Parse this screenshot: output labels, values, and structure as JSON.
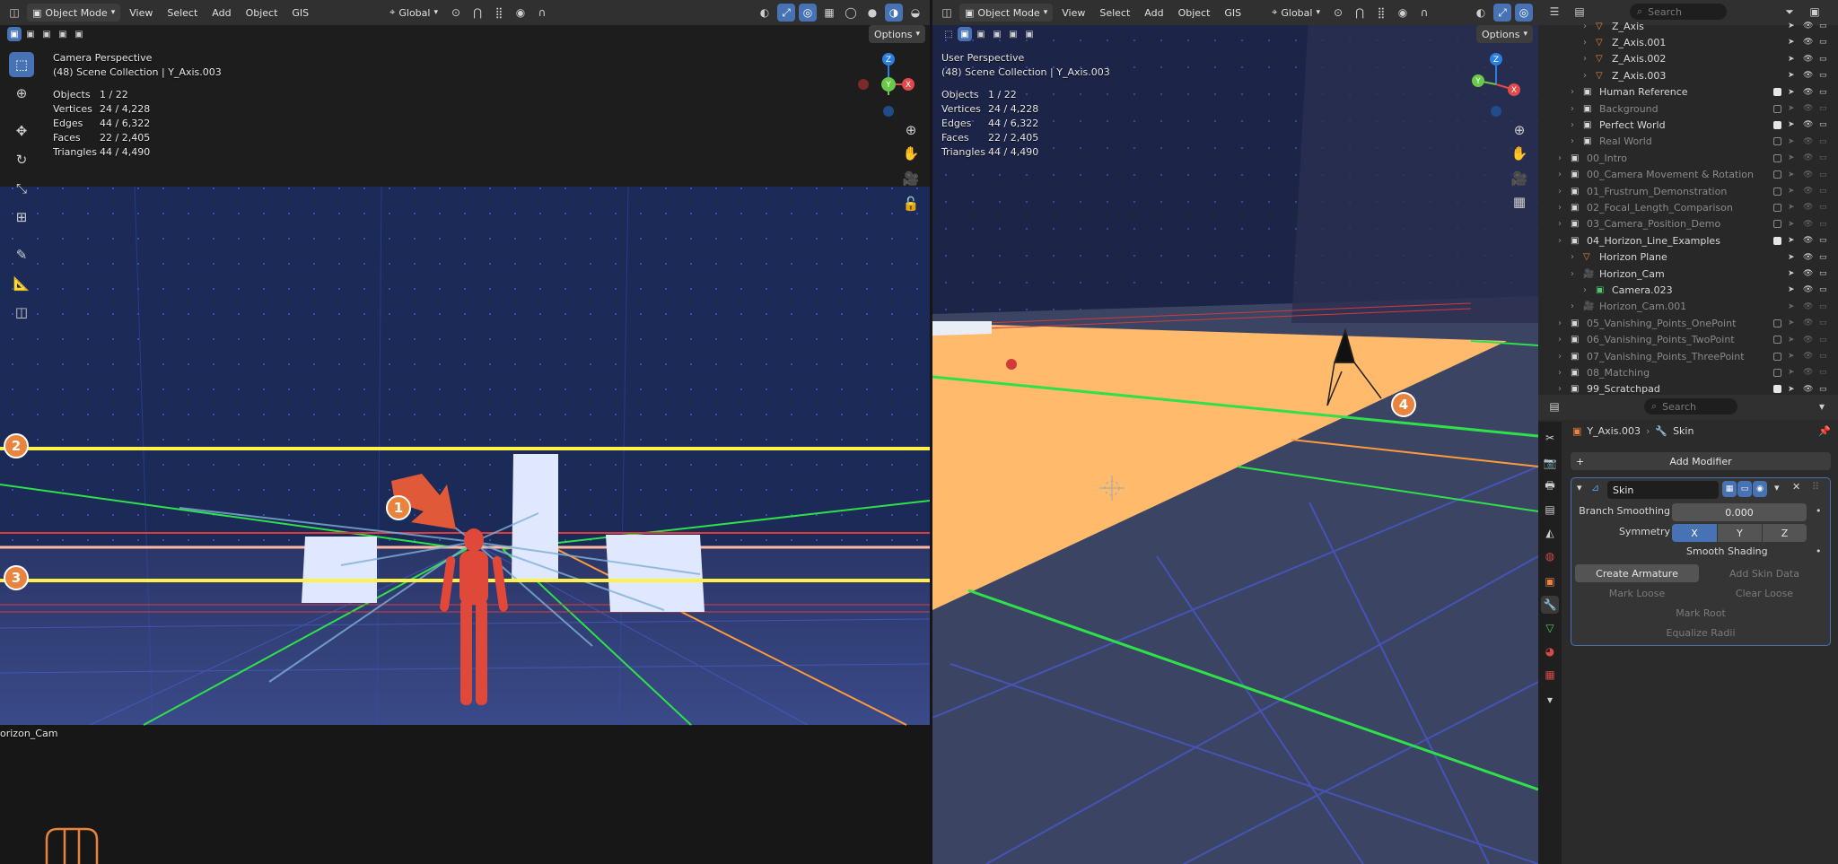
{
  "app": {
    "left_header": {
      "mode": "Object Mode",
      "menus": [
        "View",
        "Select",
        "Add",
        "Object",
        "GIS"
      ],
      "transform": "Global",
      "options": "Options"
    },
    "right_header": {
      "mode": "Object Mode",
      "menus": [
        "View",
        "Select",
        "Add",
        "Object",
        "GIS"
      ],
      "transform": "Global",
      "options": "Options"
    }
  },
  "left_viewport": {
    "title": "Camera Perspective",
    "collection": "(48) Scene Collection | Y_Axis.003",
    "stats": [
      {
        "k": "Objects",
        "v": "1 / 22"
      },
      {
        "k": "Vertices",
        "v": "24 / 4,228"
      },
      {
        "k": "Edges",
        "v": "44 / 6,322"
      },
      {
        "k": "Faces",
        "v": "22 / 2,405"
      },
      {
        "k": "Triangles",
        "v": "44 / 4,490"
      }
    ],
    "camera_name": "orizon_Cam",
    "badges": [
      "1",
      "2",
      "3"
    ]
  },
  "right_viewport": {
    "title": "User Perspective",
    "collection": "(48) Scene Collection | Y_Axis.003",
    "stats": [
      {
        "k": "Objects",
        "v": "1 / 22"
      },
      {
        "k": "Vertices",
        "v": "24 / 4,228"
      },
      {
        "k": "Edges",
        "v": "44 / 6,322"
      },
      {
        "k": "Faces",
        "v": "22 / 2,405"
      },
      {
        "k": "Triangles",
        "v": "44 / 4,490"
      }
    ],
    "badges": [
      "4"
    ]
  },
  "gizmo": {
    "x": "X",
    "y": "Y",
    "z": "Z"
  },
  "outliner": {
    "search_placeholder": "Search",
    "rows": [
      {
        "name": "Z_Axis",
        "indent": 3,
        "type": "mesh",
        "dim": false,
        "check": false
      },
      {
        "name": "Z_Axis.001",
        "indent": 3,
        "type": "mesh",
        "dim": false,
        "check": false
      },
      {
        "name": "Z_Axis.002",
        "indent": 3,
        "type": "mesh",
        "dim": false,
        "check": false
      },
      {
        "name": "Z_Axis.003",
        "indent": 3,
        "type": "mesh",
        "dim": false,
        "check": false
      },
      {
        "name": "Human Reference",
        "indent": 2,
        "type": "collection",
        "dim": false,
        "check": true
      },
      {
        "name": "Background",
        "indent": 2,
        "type": "collection",
        "dim": true,
        "check": false
      },
      {
        "name": "Perfect World",
        "indent": 2,
        "type": "collection",
        "dim": false,
        "check": true
      },
      {
        "name": "Real World",
        "indent": 2,
        "type": "collection",
        "dim": true,
        "check": false
      },
      {
        "name": "00_Intro",
        "indent": 1,
        "type": "collection",
        "dim": true,
        "check": false
      },
      {
        "name": "00_Camera Movement & Rotation",
        "indent": 1,
        "type": "collection",
        "dim": true,
        "check": false
      },
      {
        "name": "01_Frustrum_Demonstration",
        "indent": 1,
        "type": "collection",
        "dim": true,
        "check": false
      },
      {
        "name": "02_Focal_Length_Comparison",
        "indent": 1,
        "type": "collection",
        "dim": true,
        "check": false
      },
      {
        "name": "03_Camera_Position_Demo",
        "indent": 1,
        "type": "collection",
        "dim": true,
        "check": false
      },
      {
        "name": "04_Horizon_Line_Examples",
        "indent": 1,
        "type": "collection",
        "dim": false,
        "check": true
      },
      {
        "name": "Horizon Plane",
        "indent": 2,
        "type": "mesh",
        "dim": false,
        "check": false
      },
      {
        "name": "Horizon_Cam",
        "indent": 2,
        "type": "camera",
        "dim": false,
        "check": false
      },
      {
        "name": "Camera.023",
        "indent": 3,
        "type": "cameradata",
        "dim": false,
        "check": false
      },
      {
        "name": "Horizon_Cam.001",
        "indent": 2,
        "type": "camera",
        "dim": true,
        "check": false
      },
      {
        "name": "05_Vanishing_Points_OnePoint",
        "indent": 1,
        "type": "collection",
        "dim": true,
        "check": false
      },
      {
        "name": "06_Vanishing_Points_TwoPoint",
        "indent": 1,
        "type": "collection",
        "dim": true,
        "check": false
      },
      {
        "name": "07_Vanishing_Points_ThreePoint",
        "indent": 1,
        "type": "collection",
        "dim": true,
        "check": false
      },
      {
        "name": "08_Matching",
        "indent": 1,
        "type": "collection",
        "dim": true,
        "check": false
      },
      {
        "name": "99_Scratchpad",
        "indent": 1,
        "type": "collection",
        "dim": false,
        "check": true
      }
    ]
  },
  "properties": {
    "search_placeholder": "Search",
    "breadcrumb_object": "Y_Axis.003",
    "breadcrumb_modifier": "Skin",
    "add_modifier": "Add Modifier",
    "modifier_name": "Skin",
    "branch_smoothing_label": "Branch Smoothing",
    "branch_smoothing_value": "0.000",
    "symmetry_label": "Symmetry",
    "symmetry": {
      "x": "X",
      "y": "Y",
      "z": "Z"
    },
    "smooth_shading": "Smooth Shading",
    "create_armature": "Create Armature",
    "add_skin_data": "Add Skin Data",
    "mark_loose": "Mark Loose",
    "clear_loose": "Clear Loose",
    "mark_root": "Mark Root",
    "equalize_radii": "Equalize Radii"
  },
  "colors": {
    "accent": "#4772b3",
    "badge": "#e8843e",
    "horizon_yellow": "#ffeb3b",
    "ground_orange": "#ffb86c",
    "figure_red": "#e0483a"
  }
}
